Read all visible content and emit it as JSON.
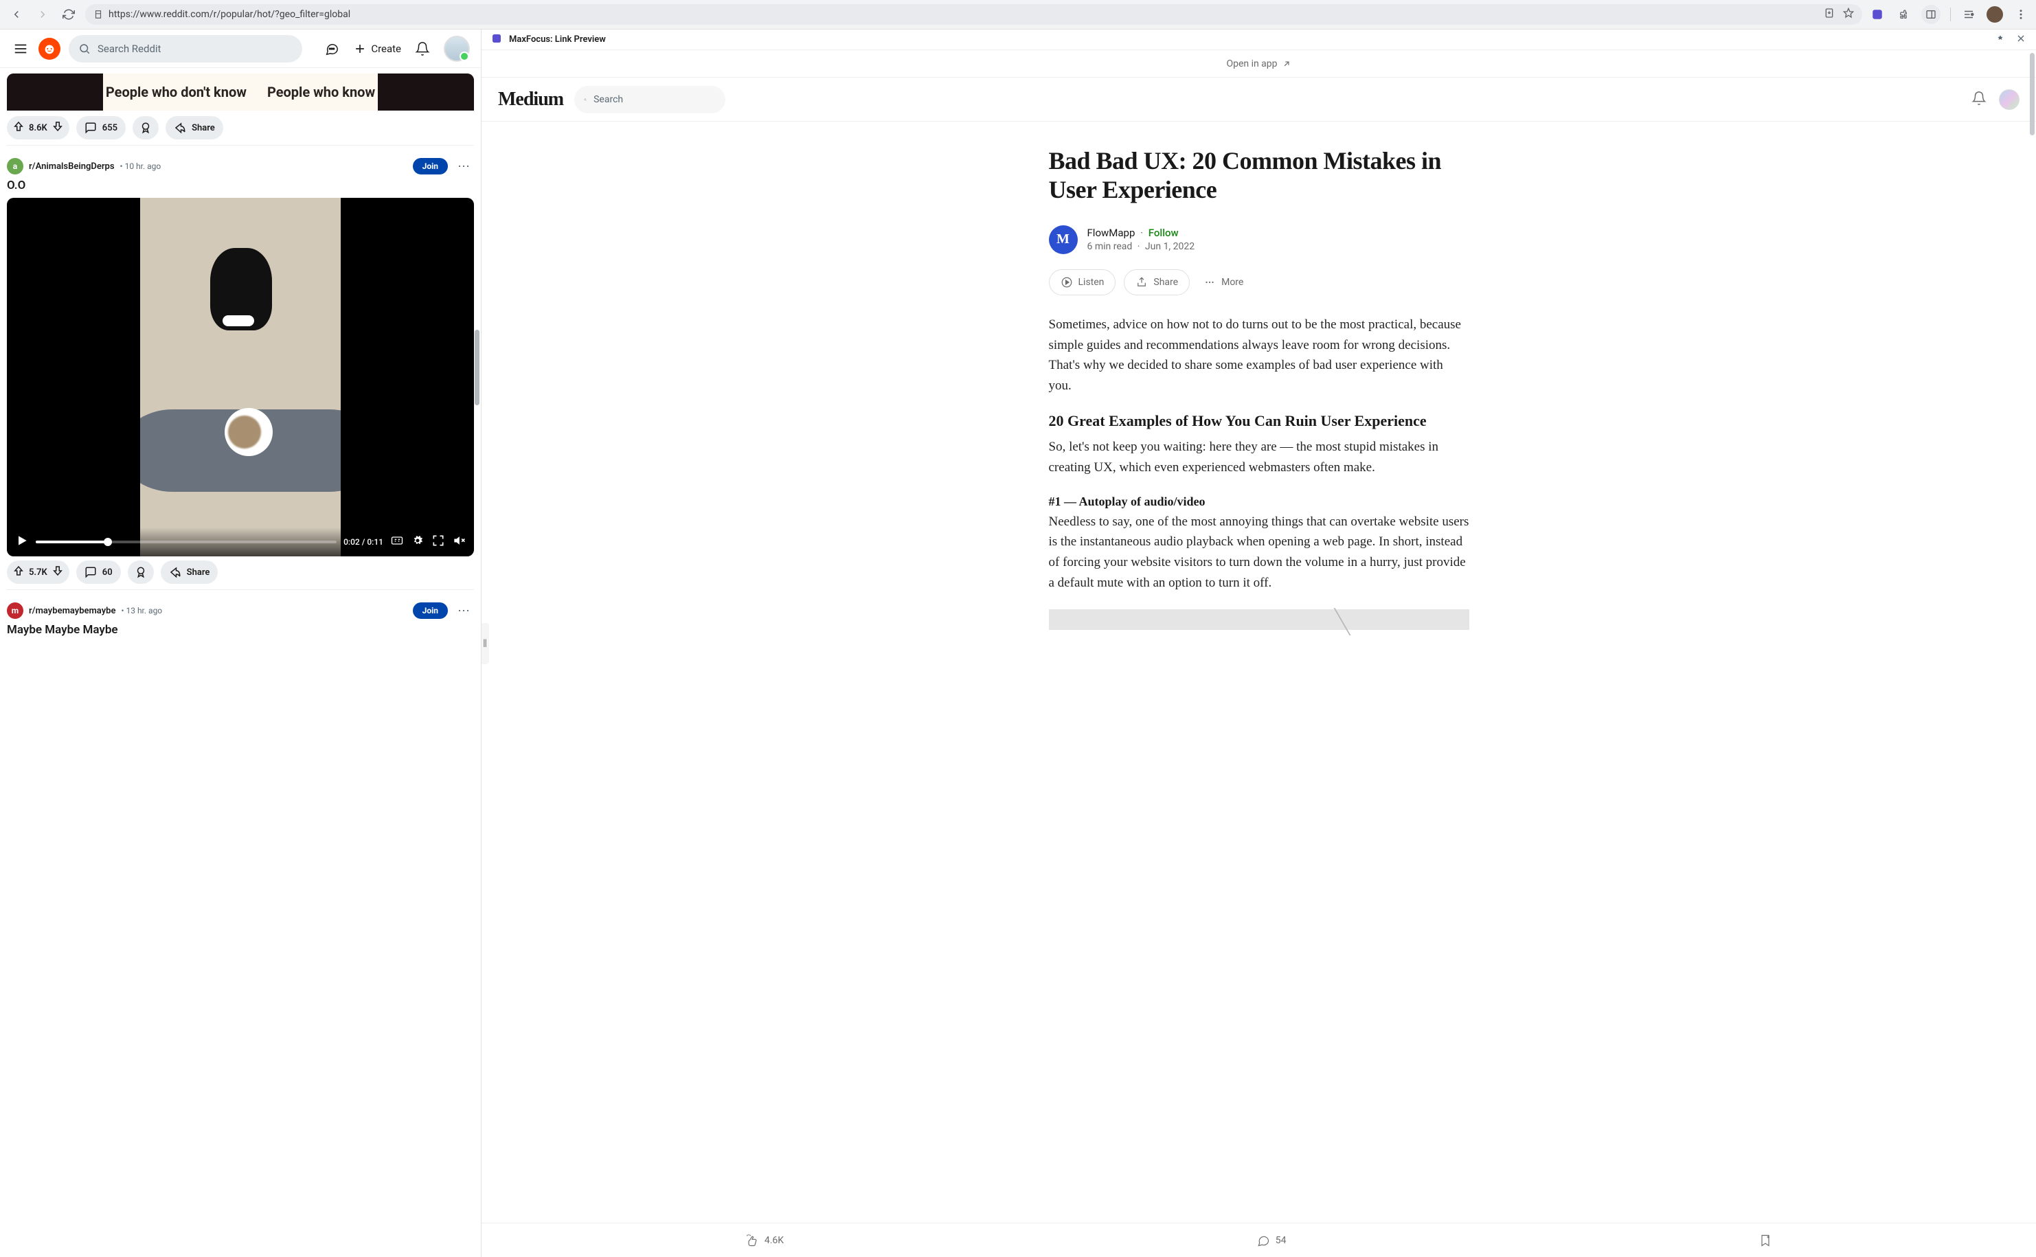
{
  "browser": {
    "url": "https://www.reddit.com/r/popular/hot/?geo_filter=global"
  },
  "reddit": {
    "search_placeholder": "Search Reddit",
    "create_label": "Create",
    "posts": [
      {
        "banner_left": "People who don't know",
        "banner_right": "People who know",
        "score": "8.6K",
        "comments": "655",
        "share": "Share"
      },
      {
        "subreddit": "r/AnimalsBeingDerps",
        "time": "10 hr. ago",
        "join": "Join",
        "title": "O.O",
        "video_time": "0:02 / 0:11",
        "score": "5.7K",
        "comments": "60",
        "share": "Share"
      },
      {
        "subreddit": "r/maybemaybemaybe",
        "time": "13 hr. ago",
        "join": "Join",
        "title": "Maybe Maybe Maybe"
      }
    ]
  },
  "preview": {
    "extension_name": "MaxFocus: Link Preview",
    "open_in_app": "Open in app",
    "medium": {
      "logo": "Medium",
      "search_placeholder": "Search"
    },
    "article": {
      "title": "Bad Bad UX: 20 Common Mistakes in User Experience",
      "author_name": "FlowMapp",
      "author_initial": "M",
      "follow": "Follow",
      "read_time": "6 min read",
      "date": "Jun 1, 2022",
      "listen": "Listen",
      "share": "Share",
      "more": "More",
      "p1": "Sometimes, advice on how not to do turns out to be the most practical, because simple guides and recommendations always leave room for wrong decisions. That's why we decided to share some examples of bad user experience with you.",
      "h2": "20 Great Examples of How You Can Ruin User Experience",
      "p2": "So, let's not keep you waiting: here they are — the most stupid mistakes in creating UX, which even experienced webmasters often make.",
      "h3": "#1 — Autoplay of audio/video",
      "p3": "Needless to say, one of the most annoying things that can overtake website users is the instantaneous audio playback when opening a web page. In short, instead of forcing your website visitors to turn down the volume in a hurry, just provide a default mute with an option to turn it off.",
      "claps": "4.6K",
      "responses": "54"
    }
  }
}
